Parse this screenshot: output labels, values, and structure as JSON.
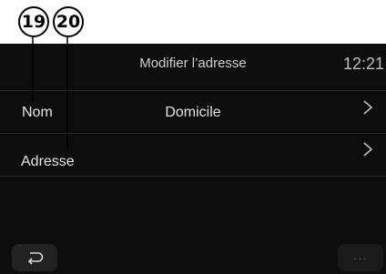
{
  "callouts": [
    "19",
    "20"
  ],
  "header": {
    "title": "Modifier l’adresse",
    "clock": "12:21"
  },
  "rows": [
    {
      "label": "Nom",
      "value": "Domicile",
      "icon": "chevron-right-icon"
    },
    {
      "label": "Adresse",
      "value": "",
      "icon": "chevron-right-icon"
    }
  ],
  "footer": {
    "back_icon": "back-arrow-icon",
    "more_label": "···"
  },
  "colors": {
    "screen_bg": "#0d0d0d",
    "text": "#e4e4e4",
    "divider": "#262626"
  }
}
